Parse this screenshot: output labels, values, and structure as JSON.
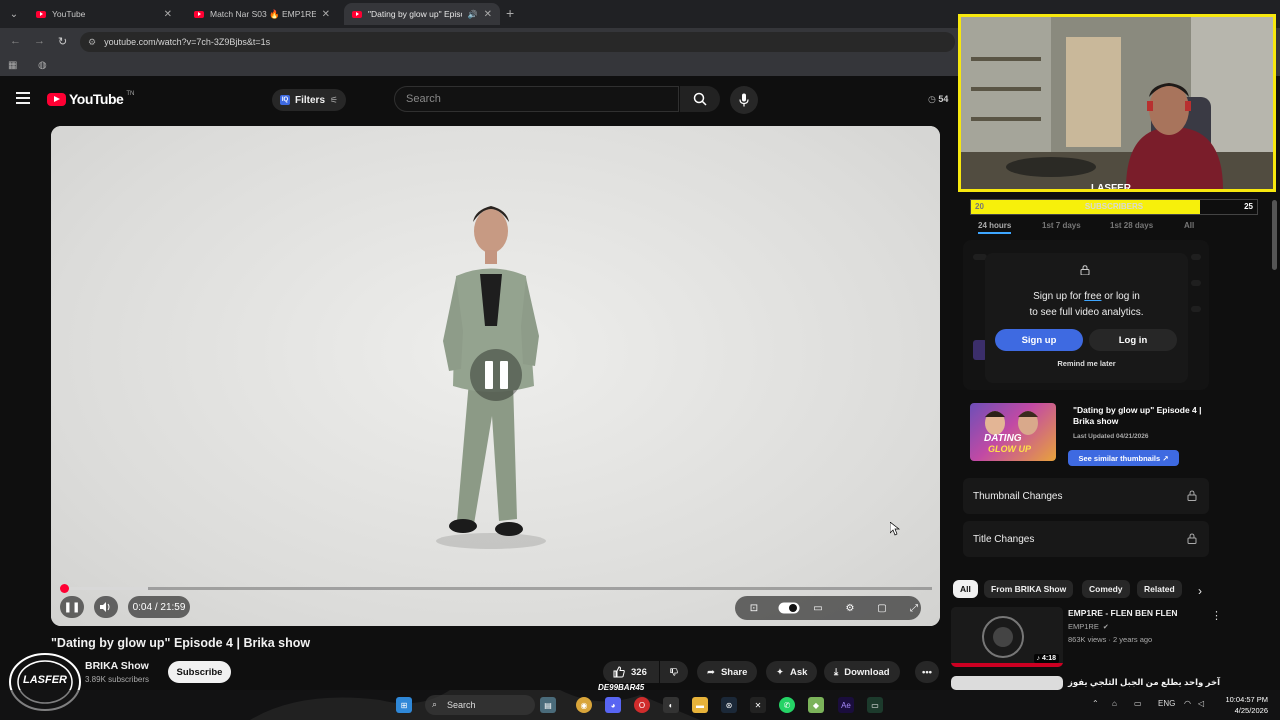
{
  "browser": {
    "tabs": [
      {
        "title": "YouTube",
        "active": false
      },
      {
        "title": "Match Nar S03 🔥 EMP1RE 🔥",
        "active": false
      },
      {
        "title": "\"Dating by glow up\" Episod",
        "active": true
      }
    ],
    "url": "youtube.com/watch?v=7ch-3Z9Bjbs&t=1s"
  },
  "header": {
    "logo_text": "YouTube",
    "logo_tm": "TN",
    "filters_label": "Filters",
    "search_placeholder": "Search",
    "timer_text": "54"
  },
  "player": {
    "current_time": "0:04",
    "duration": "21:59",
    "time_display": "0:04 / 21:59",
    "progress_fraction": 0.003,
    "buffer_fraction": 0.1
  },
  "video": {
    "title": "\"Dating by glow up\" Episode 4 | Brika show",
    "channel_name": "BRIKA Show",
    "channel_subs": "3.89K subscribers",
    "channel_avatar_text": "LASFER",
    "subscribe_label": "Subscribe",
    "likes": "326",
    "share_label": "Share",
    "ask_label": "Ask",
    "download_label": "Download"
  },
  "overlay": {
    "webcam_label": "LASFER",
    "subs_bar_left": "20",
    "subs_bar_label": "SUBSCRIBERS",
    "subs_bar_right": "25",
    "subs_progress": 0.8
  },
  "analytics": {
    "tabs": [
      "24 hours",
      "1st 7 days",
      "1st 28 days",
      "All"
    ],
    "login_line1_pre": "Sign up for ",
    "login_line1_free": "free",
    "login_line1_post": " or log in",
    "login_line2": "to see full video analytics.",
    "signup_label": "Sign up",
    "login_label": "Log in",
    "remind_label": "Remind me later",
    "thumb_title": "\"Dating by glow up\" Episode 4 | Brika show",
    "thumb_updated": "Last Updated 04/21/2026",
    "thumb_button": "See similar thumbnails ↗",
    "thumb_overlay_text1": "DATING",
    "thumb_overlay_text2": "GLOW UP",
    "thumbnail_changes": "Thumbnail Changes",
    "title_changes": "Title Changes"
  },
  "chips": [
    "All",
    "From BRIKA Show",
    "Comedy",
    "Related"
  ],
  "recommendations": [
    {
      "title": "EMP1RE - FLEN BEN FLEN",
      "channel": "EMP1RE",
      "verified": true,
      "meta": "863K views · 2 years ago",
      "duration": "4:18"
    },
    {
      "title": "آخر واحد يطلع من الجبل الثلجي يفوز",
      "channel": "",
      "verified": false,
      "meta": "",
      "duration": ""
    }
  ],
  "taskbar": {
    "search_label": "Search",
    "lang": "ENG",
    "time": "10:04:57 PM",
    "date": "4/25/2026",
    "overlay_text": "DE99BAR45"
  },
  "colors": {
    "accent_red": "#ff0033",
    "accent_blue": "#3e6ae1",
    "overlay_yellow": "#f7e80e"
  }
}
